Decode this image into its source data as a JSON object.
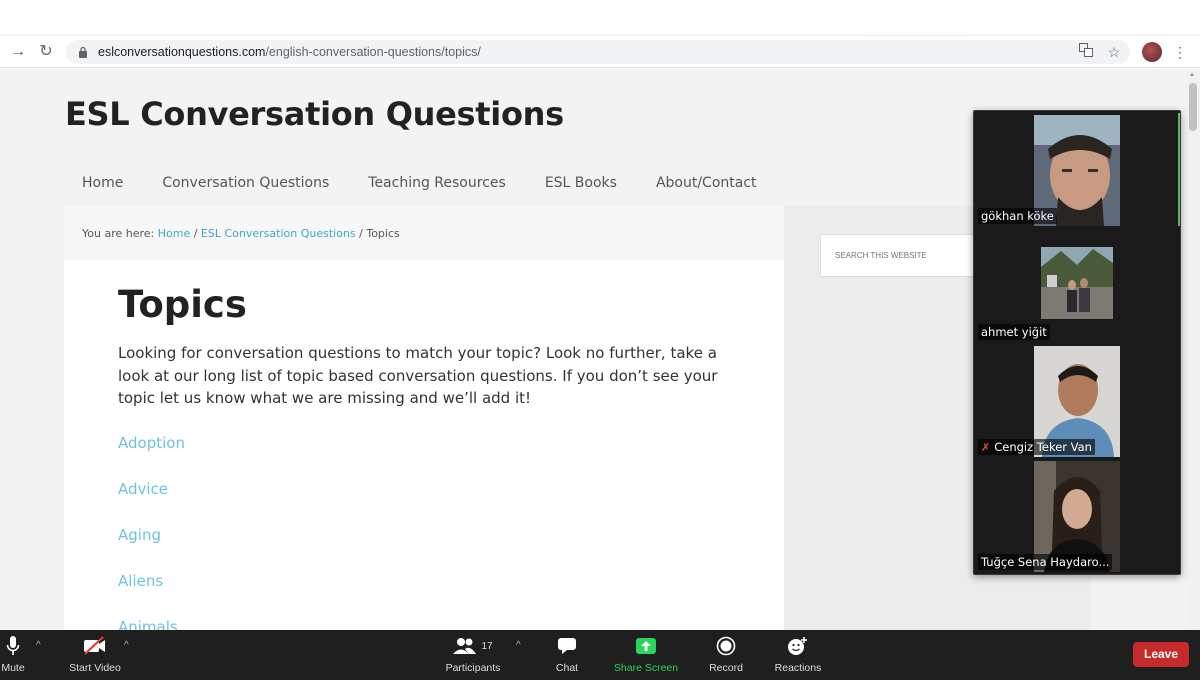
{
  "browser": {
    "url_host": "eslconversationquestions.com",
    "url_path": "/english-conversation-questions/topics/"
  },
  "site": {
    "title": "ESL Conversation Questions",
    "nav": [
      "Home",
      "Conversation Questions",
      "Teaching Resources",
      "ESL Books",
      "About/Contact"
    ]
  },
  "breadcrumb": {
    "prefix": "You are here: ",
    "home": "Home",
    "sep1": " / ",
    "section": "ESL Conversation Questions",
    "sep2": " / ",
    "current": "Topics"
  },
  "main": {
    "heading": "Topics",
    "intro": "Looking for conversation questions to match your topic? Look no further, take a look at our long list of topic based conversation questions. If you don’t see your topic let us know what we are missing and we’ll add it!",
    "topics": [
      "Adoption",
      "Advice",
      "Aging",
      "Aliens",
      "Animals"
    ]
  },
  "sidebar": {
    "search_placeholder": "SEARCH THIS WEBSITE"
  },
  "participants": [
    {
      "name": "gökhan köke"
    },
    {
      "name": "ahmet yiğit"
    },
    {
      "name": "Cengiz Teker Van",
      "muted": true
    },
    {
      "name": "Tuğçe Sena Haydaro..."
    }
  ],
  "zoom_toolbar": {
    "mute": "Mute",
    "start_video": "Start Video",
    "participants": "Participants",
    "participant_count": "17",
    "chat": "Chat",
    "share_screen": "Share Screen",
    "record": "Record",
    "reactions": "Reactions",
    "leave": "Leave"
  },
  "colors": {
    "link": "#3fa5c9",
    "topic_link": "#6cc3df",
    "share_green": "#2bd45a",
    "leave_red": "#c72a2a",
    "zoom_bar": "#1f1f1f"
  }
}
